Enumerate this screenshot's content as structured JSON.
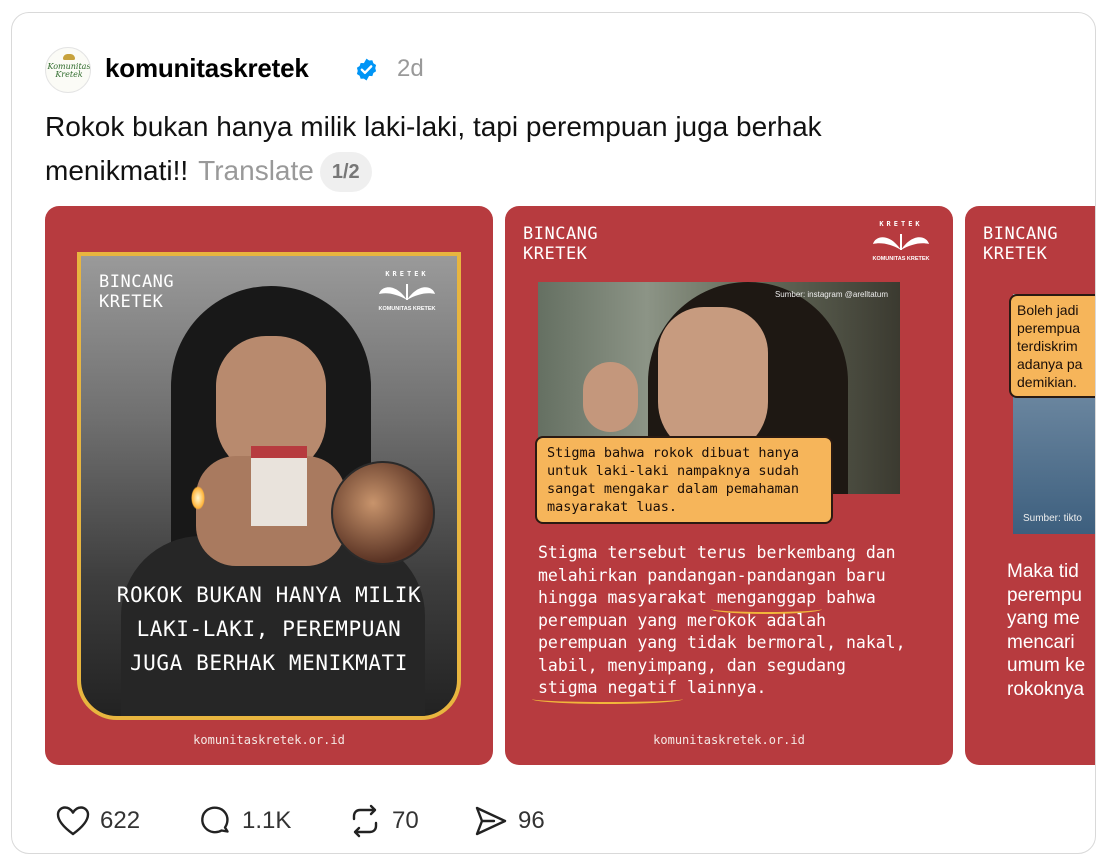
{
  "post": {
    "username": "komunitaskretek",
    "time": "2d",
    "caption_line1": "Rokok bukan hanya milik laki-laki, tapi perempuan juga berhak",
    "caption_line2": "menikmati!!",
    "translate": "Translate",
    "page_indicator": "1/2",
    "avatar_text_line1": "Komunitas",
    "avatar_text_line2": "Kretek",
    "verified_icon": "verified-badge-icon"
  },
  "slides": [
    {
      "brand": "BINCANG\nKRETEK",
      "logo_top": "KRETEK",
      "logo_sub": "KOMUNITAS KRETEK",
      "title_line1": "ROKOK BUKAN HANYA MILIK",
      "title_line2": "LAKI-LAKI, PEREMPUAN",
      "title_line3": "JUGA BERHAK MENIKMATI",
      "footer": "komunitaskretek.or.id"
    },
    {
      "brand": "BINCANG\nKRETEK",
      "logo_top": "KRETEK",
      "logo_sub": "KOMUNITAS KRETEK",
      "source": "Sumber: instagram @arelltatum",
      "bubble": "Stigma bahwa rokok dibuat hanya untuk laki-laki nampaknya sudah sangat mengakar dalam pemahaman masyarakat luas.",
      "body_pre": "Stigma tersebut terus berkembang dan melahirkan pandangan-pandangan baru hingga masyarakat ",
      "body_hl1": "menganggap",
      "body_mid": " bahwa perempuan yang merokok adalah perempuan yang tidak bermoral, nakal, labil, menyimpang, dan segudang ",
      "body_hl2": "stigma negatif",
      "body_post": " lainnya.",
      "footer": "komunitaskretek.or.id"
    },
    {
      "brand": "BINCANG\nKRETEK",
      "bubble": "Boleh jadi\nperempua\nterdiskrim\nadanya pa\ndemikian.",
      "source": "Sumber: tikto",
      "body": "Maka tid\nperempu\nyang me\nmencari\numum ke\nrokoknya"
    }
  ],
  "actions": {
    "likes": "622",
    "replies": "1.1K",
    "reposts": "70",
    "shares": "96"
  },
  "colors": {
    "slide_bg": "#b73b3f",
    "accent_yellow": "#f6b55a",
    "verified_blue": "#0095f6"
  }
}
